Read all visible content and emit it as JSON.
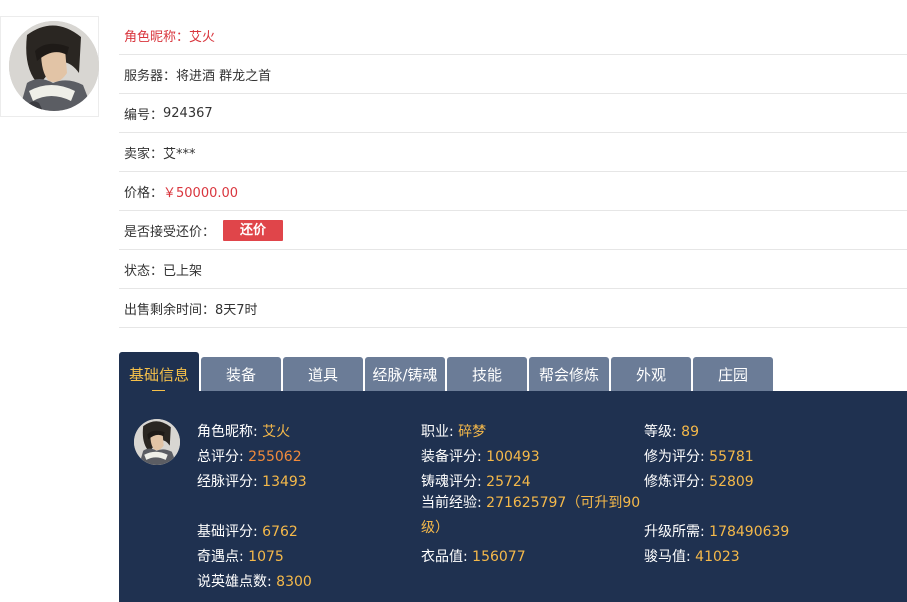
{
  "info": {
    "nickname_label": "角色昵称：",
    "nickname_value": "艾火",
    "server_label": "服务器：",
    "server_value": "将进酒 群龙之首",
    "id_label": "编号：",
    "id_value": "924367",
    "seller_label": "卖家：",
    "seller_value": "艾***",
    "price_label": "价格：",
    "price_value": "￥50000.00",
    "counter_label": "是否接受还价：",
    "counter_button": "还价",
    "status_label": "状态：",
    "status_value": "已上架",
    "remaining_label": "出售剩余时间：",
    "remaining_value": "8天7时"
  },
  "tabs": [
    {
      "label": "基础信息",
      "active": true
    },
    {
      "label": "装备"
    },
    {
      "label": "道具"
    },
    {
      "label": "经脉/铸魂"
    },
    {
      "label": "技能"
    },
    {
      "label": "帮会修炼"
    },
    {
      "label": "外观"
    },
    {
      "label": "庄园"
    }
  ],
  "stats": {
    "nickname": {
      "label": "角色昵称: ",
      "value": "艾火"
    },
    "job": {
      "label": "职业: ",
      "value": "碎梦"
    },
    "level": {
      "label": "等级: ",
      "value": "89"
    },
    "total_score": {
      "label": "总评分: ",
      "value": "255062"
    },
    "equip_score": {
      "label": "装备评分: ",
      "value": "100493"
    },
    "cultivation_score": {
      "label": "修为评分: ",
      "value": "55781"
    },
    "meridian_score": {
      "label": "经脉评分: ",
      "value": "13493"
    },
    "soul_score": {
      "label": "铸魂评分: ",
      "value": "25724"
    },
    "refine_score": {
      "label": "修炼评分: ",
      "value": "52809"
    },
    "current_exp": {
      "label": "当前经验: ",
      "value": "271625797（可升到90级）"
    },
    "base_score": {
      "label": "基础评分: ",
      "value": "6762"
    },
    "upgrade_need": {
      "label": "升级所需: ",
      "value": "178490639"
    },
    "adventure": {
      "label": "奇遇点: ",
      "value": "1075"
    },
    "costume": {
      "label": "衣品值: ",
      "value": "156077"
    },
    "horse": {
      "label": "骏马值: ",
      "value": "41023"
    },
    "hero_points": {
      "label": "说英雄点数: ",
      "value": "8300"
    }
  },
  "colors": {
    "panel_bg": "#1f3150",
    "tab_bg": "#6b7c97",
    "tab_active_text": "#f5c04a",
    "stat_value": "#f5b94a",
    "total_score_value": "#f08a3c",
    "price_red": "#d9363e",
    "counter_button_bg": "#e0454a"
  }
}
